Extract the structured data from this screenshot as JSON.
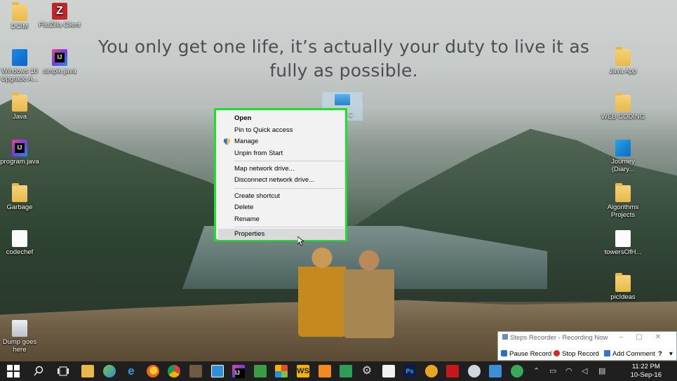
{
  "quote": {
    "line1": "You only get one life, it’s actually your duty to live it as",
    "line2": "fully as possible."
  },
  "desktop_icons": {
    "dcim": "DCIM",
    "filezilla": "FileZilla Client",
    "win10_l1": "Windows 10",
    "win10_l2": "Upgrade A...",
    "simple_java": "simple.java",
    "java": "Java",
    "program_java": "program.java",
    "garbage": "Garbage",
    "codechef": "codechef",
    "dump_l1": "Dump goes",
    "dump_l2": "here",
    "java_app": "Java App",
    "web_coding": "WEB CODING",
    "journey_l1": "Journey",
    "journey_l2": "(Diary...",
    "algo_l1": "Algorithms",
    "algo_l2": "Projects",
    "towers": "towersOfH...",
    "picideas": "picIdeas",
    "thispc_partial": "C"
  },
  "context_menu": {
    "open": "Open",
    "pin_quick": "Pin to Quick access",
    "manage": "Manage",
    "unpin_start": "Unpin from Start",
    "map_drive": "Map network drive...",
    "disconnect_drive": "Disconnect network drive...",
    "create_shortcut": "Create shortcut",
    "delete": "Delete",
    "rename": "Rename",
    "properties": "Properties"
  },
  "steps_recorder": {
    "title": "Steps Recorder - Recording Now",
    "pause": "Pause Record",
    "stop": "Stop Record",
    "add_comment": "Add Comment",
    "help": "?"
  },
  "clock": {
    "time": "11:22 PM",
    "date": "10-Sep-16"
  },
  "colors": {
    "highlight_border": "#1ee02a",
    "taskbar": "#1f1f1f"
  }
}
